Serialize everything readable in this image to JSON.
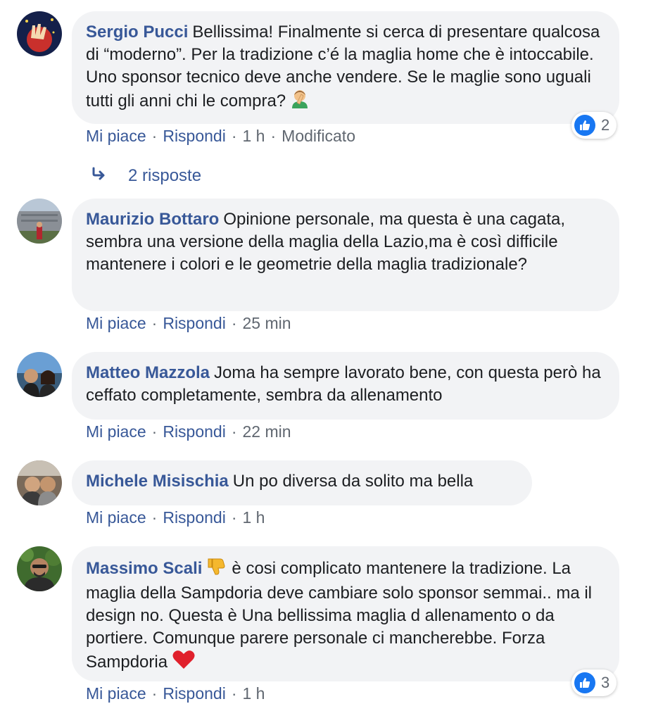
{
  "comments": [
    {
      "author": "Sergio Pucci",
      "text": "Bellissima! Finalmente si cerca di presentare qualcosa di “moderno”. Per la tradizione c’é la maglia home che è intoccabile. Uno sponsor tecnico deve anche vendere. Se le maglie sono uguali tutti gli anni chi le compra?",
      "emoji": "facepalm-emoji",
      "like_label": "Mi piace",
      "reply_label": "Rispondi",
      "time": "1 h",
      "edited": "Modificato",
      "reaction_count": "2"
    },
    {
      "author": "Maurizio Bottaro",
      "text": "Opinione personale, ma questa è una cagata, sembra una versione della maglia della Lazio,ma è così difficile mantenere i colori e le geometrie della maglia tradizionale?",
      "like_label": "Mi piace",
      "reply_label": "Rispondi",
      "time": "25 min"
    },
    {
      "author": "Matteo Mazzola",
      "text": "Joma ha sempre lavorato bene, con questa però ha ceffato completamente, sembra da allenamento",
      "like_label": "Mi piace",
      "reply_label": "Rispondi",
      "time": "22 min"
    },
    {
      "author": "Michele Misischia",
      "text": "Un po diversa da solito ma bella",
      "like_label": "Mi piace",
      "reply_label": "Rispondi",
      "time": "1 h"
    },
    {
      "author": "Massimo Scali",
      "emoji_lead": "thumbs-down-emoji",
      "text": "è cosi complicato mantenere la tradizione. La maglia della Sampdoria deve cambiare solo sponsor semmai.. ma il design no. Questa è Una bellissima maglia d allenamento o da portiere. Comunque parere personale ci mancherebbe. Forza Sampdoria",
      "emoji": "red-heart-emoji",
      "like_label": "Mi piace",
      "reply_label": "Rispondi",
      "time": "1 h",
      "reaction_count": "3"
    }
  ],
  "replies_link": "2 risposte",
  "colors": {
    "link": "#385898",
    "bubble": "#f2f3f5",
    "like": "#1877f2",
    "meta": "#606770"
  }
}
